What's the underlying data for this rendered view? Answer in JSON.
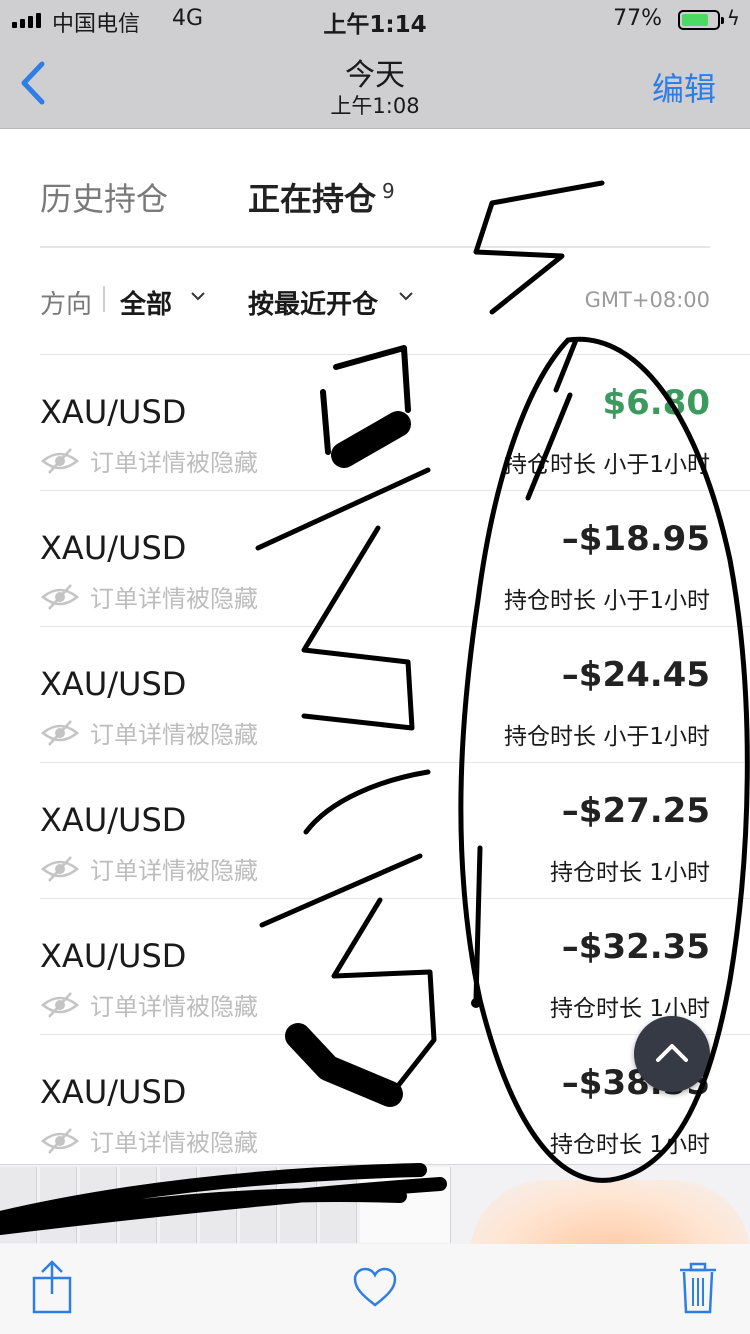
{
  "status_bar": {
    "carrier": "中国电信",
    "network": "4G",
    "time": "上午1:14",
    "battery_percent": "77%",
    "battery_level": 0.77
  },
  "nav": {
    "title": "今天",
    "subtitle": "上午1:08",
    "edit_label": "编辑"
  },
  "tabs": {
    "history_label": "历史持仓",
    "open_label": "正在持仓",
    "open_count": "9"
  },
  "filters": {
    "direction_label": "方向",
    "direction_value": "全部",
    "sort_value": "按最近开仓",
    "timezone": "GMT+08:00"
  },
  "positions": [
    {
      "symbol": "XAU/USD",
      "hidden_text": "订单详情被隐藏",
      "pnl": "$6.80",
      "duration": "持仓时长 小于1小时"
    },
    {
      "symbol": "XAU/USD",
      "hidden_text": "订单详情被隐藏",
      "pnl": "–$18.95",
      "duration": "持仓时长 小于1小时"
    },
    {
      "symbol": "XAU/USD",
      "hidden_text": "订单详情被隐藏",
      "pnl": "–$24.45",
      "duration": "持仓时长 小于1小时"
    },
    {
      "symbol": "XAU/USD",
      "hidden_text": "订单详情被隐藏",
      "pnl": "–$27.25",
      "duration": "持仓时长 1小时"
    },
    {
      "symbol": "XAU/USD",
      "hidden_text": "订单详情被隐藏",
      "pnl": "–$32.35",
      "duration": "持仓时长 1小时"
    },
    {
      "symbol": "XAU/USD",
      "hidden_text": "订单详情被隐藏",
      "pnl": "–$38.55",
      "duration": "持仓时长 1小时"
    }
  ],
  "icons": {
    "back": "chevron-left-icon",
    "eye_hidden": "eye-slash-icon",
    "chevron_down": "chevron-down-icon",
    "scroll_top": "chevron-up-icon",
    "share": "share-icon",
    "favorite": "heart-icon",
    "delete": "trash-icon"
  },
  "colors": {
    "accent_blue": "#2f7ee6",
    "profit_green": "#3d9a5f",
    "battery_green": "#4cd964"
  }
}
